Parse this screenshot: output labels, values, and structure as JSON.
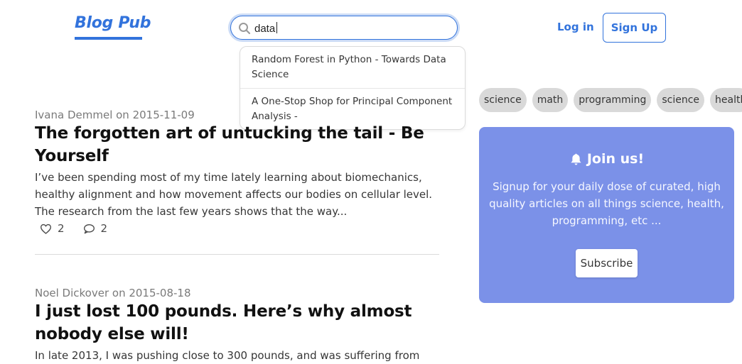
{
  "header": {
    "logo": "Blog Pub",
    "login_label": "Log in",
    "signup_label": "Sign Up"
  },
  "search": {
    "value": "data",
    "placeholder": "",
    "suggestions": [
      "Random Forest in Python - Towards Data Science",
      "A One-Stop Shop for Principal Component Analysis -"
    ]
  },
  "posts": [
    {
      "author": "Ivana Demmel",
      "date": "2015-11-09",
      "meta": "Ivana Demmel on 2015-11-09",
      "title": "The forgotten art of untucking the tail - Be Yourself",
      "excerpt": "I’ve been spending most of my time lately learning about biomechanics, healthy alignment and how movement affects our bodies on cellular level. The research from the last few years shows that the way...",
      "likes": "2",
      "comments": "2"
    },
    {
      "author": "Noel Dickover",
      "date": "2015-08-18",
      "meta": "Noel Dickover on 2015-08-18",
      "title": "I just lost 100 pounds. Here’s why almost nobody else will!",
      "excerpt": "In late 2013, I was pushing close to 300 pounds, and was suffering from"
    }
  ],
  "sidebar": {
    "tags": [
      "science",
      "math",
      "programming",
      "science",
      "health"
    ],
    "join": {
      "title": "Join us!",
      "text": "Signup for your daily dose of curated, high quality articles on all things science, health, programming, etc ...",
      "button": "Subscribe"
    }
  },
  "colors": {
    "accent": "#3273dc",
    "card": "#7b91e8",
    "tag_bg": "#d9d9d9"
  },
  "icons": [
    "search-icon",
    "heart-icon",
    "comment-icon",
    "bell-icon"
  ]
}
